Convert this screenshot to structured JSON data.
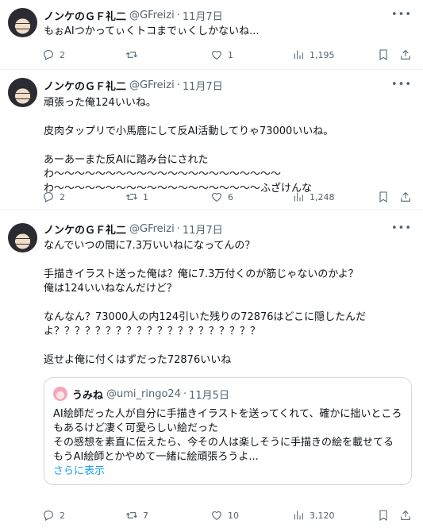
{
  "tweets": [
    {
      "author": {
        "name": "ノンケのＧＦ礼二",
        "handle": "@GFreizi",
        "dot": "·",
        "date": "11月7日"
      },
      "text": "もぉAIつかってぃくトコまでぃくしかないね...",
      "stats": {
        "replies": "2",
        "retweets": "",
        "likes": "1",
        "views": "1,195"
      }
    },
    {
      "author": {
        "name": "ノンケのＧＦ礼二",
        "handle": "@GFreizi",
        "dot": "·",
        "date": "11月7日"
      },
      "text": "頑張った俺124いいね。\n\n皮肉タップリで小馬鹿にして反AI活動してりゃ73000いいね。\n\nあーあーまた反AIに踏み台にされたわ〜〜〜〜〜〜〜〜〜〜〜〜〜〜〜〜〜〜〜〜〜〜わ〜〜〜〜〜〜〜〜〜〜〜〜〜〜〜〜〜〜〜〜ふざけんな",
      "stats": {
        "replies": "2",
        "retweets": "1",
        "likes": "6",
        "views": "1,248"
      }
    },
    {
      "author": {
        "name": "ノンケのＧＦ礼二",
        "handle": "@GFreizi",
        "dot": "·",
        "date": "11月7日"
      },
      "text": "なんでいつの間に7.3万いいねになってんの？\n\n手描きイラスト送った俺は？俺に7.3万付くのが筋じゃないのかよ？\n俺は124いいねなんだけど？\n\nなんなん？73000人の内124引いた残りの72876はどこに隠したんだよ？？？？？？？？？？？？？？？？？？？？\n\n返せよ俺に付くはずだった72876いいね",
      "quote": {
        "name": "うみね",
        "handle": "@umi_ringo24",
        "dot": "·",
        "date": "11月5日",
        "text": "AI絵師だった人が自分に手描きイラストを送ってくれて、確かに拙いところもあるけど凄く可愛らしい絵だった\nその感想を素直に伝えたら、今その人は楽しそうに手描きの絵を載せてる\nもうAI絵師とかやめて一緒に絵頑張ろうよ...",
        "show_more": "さらに表示"
      },
      "stats": {
        "replies": "2",
        "retweets": "7",
        "likes": "10",
        "views": "3,120"
      }
    }
  ],
  "colors": {
    "text": "#0f1419",
    "secondary": "#536471",
    "link": "#1d9bf0",
    "border": "#eff3f4"
  }
}
